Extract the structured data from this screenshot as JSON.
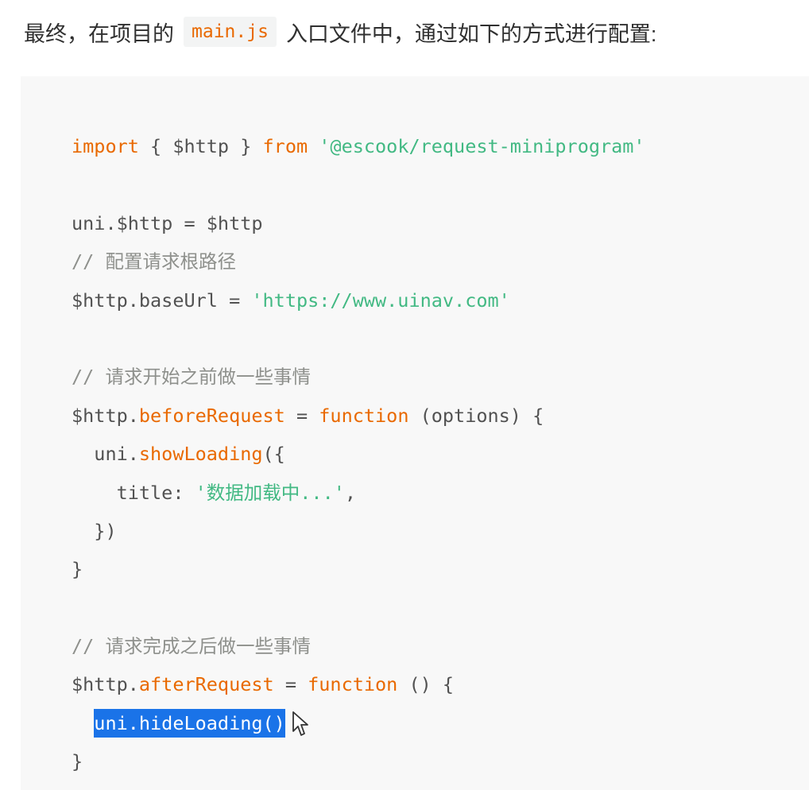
{
  "intro": {
    "before": "最终，在项目的",
    "code": "main.js",
    "after": "入口文件中，通过如下的方式进行配置:"
  },
  "code_lines": {
    "l1": {
      "kw1": "import",
      "p1": " { $http } ",
      "kw2": "from",
      "sp": " ",
      "str": "'@escook/request-miniprogram'"
    },
    "l3": {
      "p1": "uni.$http = $http"
    },
    "l4": {
      "cm": "// 配置请求根路径"
    },
    "l5": {
      "p1": "$http.baseUrl = ",
      "str": "'https://www.uinav.com'"
    },
    "l7": {
      "cm": "// 请求开始之前做一些事情"
    },
    "l8": {
      "p1": "$http.",
      "fn": "beforeRequest",
      "p2": " = ",
      "kw": "function",
      "p3": " (options) {"
    },
    "l9": {
      "p1": "  uni.",
      "fn": "showLoading",
      "p2": "({"
    },
    "l10": {
      "p1": "    title: ",
      "str": "'数据加载中...'",
      "p2": ","
    },
    "l11": {
      "p1": "  })"
    },
    "l12": {
      "p1": "}"
    },
    "l14": {
      "cm": "// 请求完成之后做一些事情"
    },
    "l15": {
      "p1": "$http.",
      "fn": "afterRequest",
      "p2": " = ",
      "kw": "function",
      "p3": " () {"
    },
    "l16": {
      "indent": "  ",
      "sel": "uni.hideLoading()"
    },
    "l17": {
      "p1": "}"
    }
  },
  "icons": {
    "cursor": "mouse-pointer-icon"
  },
  "colors": {
    "keyword": "#e96900",
    "string": "#42b983",
    "comment": "#8e908c",
    "selection": "#1a73e8",
    "code_background": "#f8f8f8"
  }
}
